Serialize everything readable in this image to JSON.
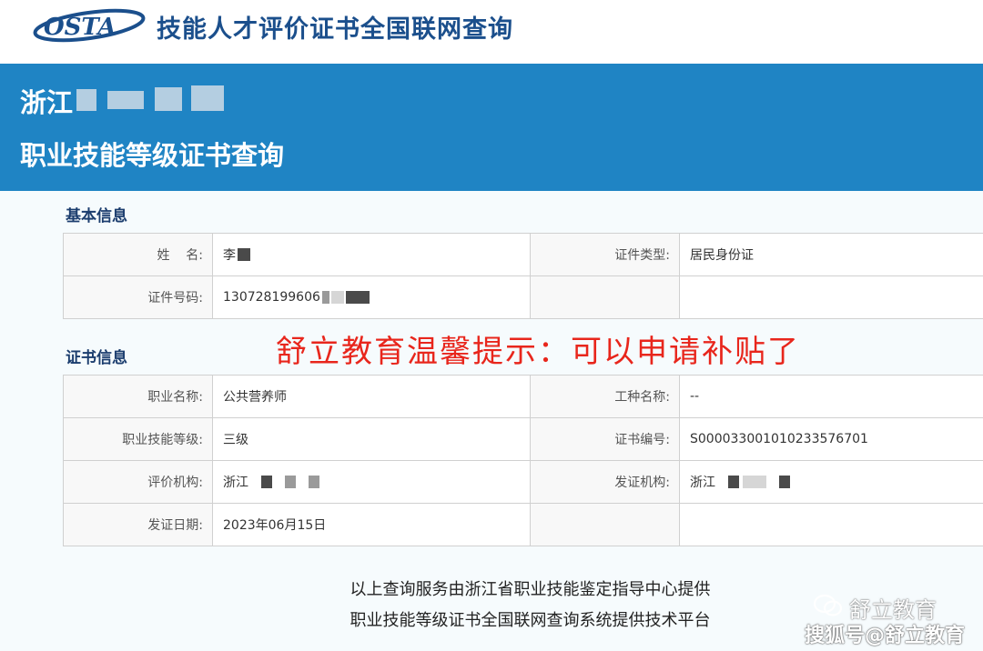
{
  "header": {
    "logo_text": "OSTA",
    "site_title": "技能人才评价证书全国联网查询"
  },
  "banner": {
    "org_prefix": "浙江",
    "page_title": "职业技能等级证书查询"
  },
  "basic_info": {
    "heading": "基本信息",
    "name_label": "姓    名:",
    "name_value": "李",
    "id_type_label": "证件类型:",
    "id_type_value": "居民身份证",
    "id_number_label": "证件号码:",
    "id_number_value": "130728199606"
  },
  "notice": "舒立教育温馨提示：可以申请补贴了",
  "cert_info": {
    "heading": "证书信息",
    "occupation_label": "职业名称:",
    "occupation_value": "公共营养师",
    "job_type_label": "工种名称:",
    "job_type_value": "--",
    "level_label": "职业技能等级:",
    "level_value": "三级",
    "cert_no_label": "证书编号:",
    "cert_no_value": "S000033001010233576701",
    "eval_org_label": "评价机构:",
    "eval_org_value": "浙江",
    "issue_org_label": "发证机构:",
    "issue_org_value": "浙江",
    "issue_date_label": "发证日期:",
    "issue_date_value": "2023年06月15日"
  },
  "footer": {
    "line1": "以上查询服务由浙江省职业技能鉴定指导中心提供",
    "line2": "职业技能等级证书全国联网查询系统提供技术平台"
  },
  "watermark": {
    "brand": "舒立教育",
    "source": "搜狐号@舒立教育"
  },
  "colors": {
    "banner": "#1f84c4",
    "title_blue": "#1b4f8c",
    "notice_red": "#e8261c"
  }
}
